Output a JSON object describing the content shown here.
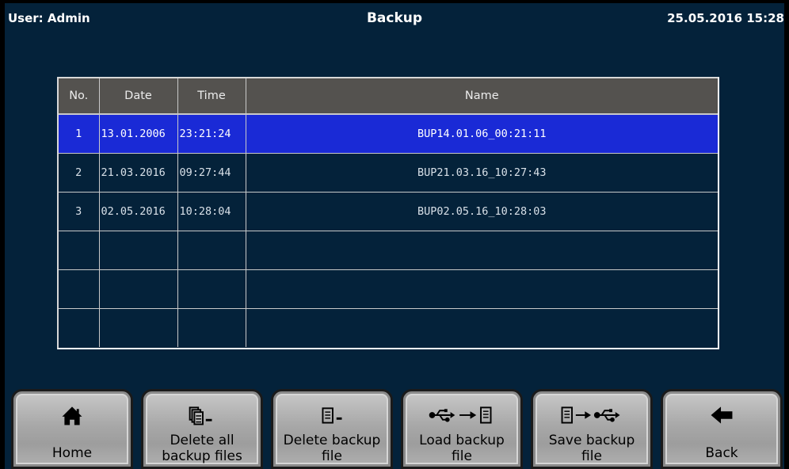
{
  "header": {
    "user": "User: Admin",
    "title": "Backup",
    "datetime": "25.05.2016  15:28"
  },
  "table": {
    "columns": [
      "No.",
      "Date",
      "Time",
      "Name"
    ],
    "rows": [
      {
        "no": "1",
        "date": "13.01.2006",
        "time": "23:21:24",
        "name": "BUP14.01.06_00:21:11",
        "selected": true
      },
      {
        "no": "2",
        "date": "21.03.2016",
        "time": "09:27:44",
        "name": "BUP21.03.16_10:27:43",
        "selected": false
      },
      {
        "no": "3",
        "date": "02.05.2016",
        "time": "10:28:04",
        "name": "BUP02.05.16_10:28:03",
        "selected": false
      },
      {
        "no": "",
        "date": "",
        "time": "",
        "name": "",
        "selected": false
      },
      {
        "no": "",
        "date": "",
        "time": "",
        "name": "",
        "selected": false
      },
      {
        "no": "",
        "date": "",
        "time": "",
        "name": "",
        "selected": false
      }
    ]
  },
  "buttons": {
    "home": {
      "line1": "Home",
      "icon": "home-icon"
    },
    "delete_all": {
      "line1": "Delete all",
      "line2": "backup files",
      "icon": "delete-all-files-icon"
    },
    "delete_file": {
      "line1": "Delete backup",
      "line2": "file",
      "icon": "delete-file-icon"
    },
    "load_file": {
      "line1": "Load backup",
      "line2": "file",
      "icon": "usb-to-file-icon"
    },
    "save_file": {
      "line1": "Save backup",
      "line2": "file",
      "icon": "file-to-usb-icon"
    },
    "back": {
      "line1": "Back",
      "icon": "back-arrow-icon"
    }
  },
  "colors": {
    "background": "#04223a",
    "header_row": "#54524f",
    "selected_row": "#1a2ad6"
  }
}
